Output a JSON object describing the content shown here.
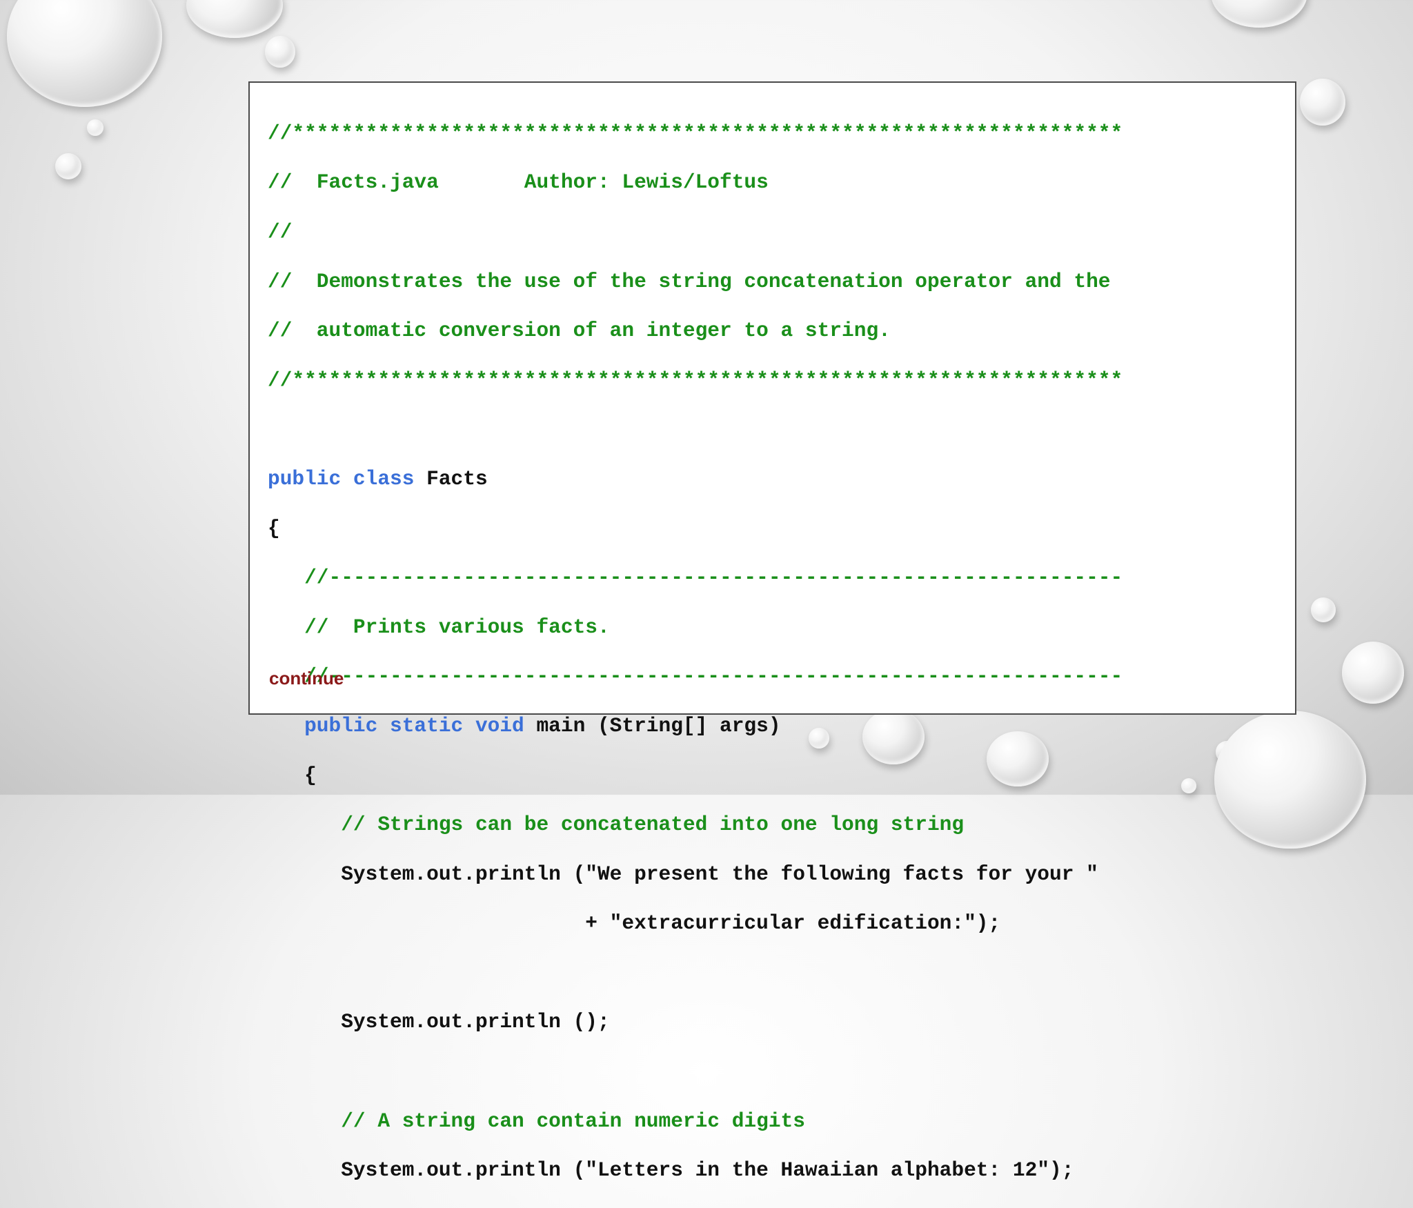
{
  "code": {
    "banner_top": "//********************************************************************",
    "header_line1_prefix": "//  ",
    "header_filename": "Facts.java",
    "header_author": "Author: Lewis/Loftus",
    "header_blank": "//",
    "desc_line1": "//  Demonstrates the use of the string concatenation operator and the",
    "desc_line2": "//  automatic conversion of an integer to a string.",
    "banner_bottom": "//********************************************************************",
    "kw_public": "public",
    "kw_class": "class",
    "class_name": "Facts",
    "open_brace": "{",
    "method_sep_top": "//-----------------------------------------------------------------",
    "method_comment": "//  Prints various facts.",
    "method_sep_bottom": "//-----------------------------------------------------------------",
    "kw_static": "static",
    "kw_void": "void",
    "method_signature": "main (String[] args)",
    "method_open_brace": "{",
    "comment_concat": "// Strings can be concatenated into one long string",
    "println_1a": "System.out.println (\"We present the following facts for your \"",
    "println_1b": "+ \"extracurricular edification:\");",
    "println_2": "System.out.println ();",
    "comment_digits": "// A string can contain numeric digits",
    "println_3": "System.out.println (\"Letters in the Hawaiian alphabet: 12\");"
  },
  "continue_label": "continue"
}
